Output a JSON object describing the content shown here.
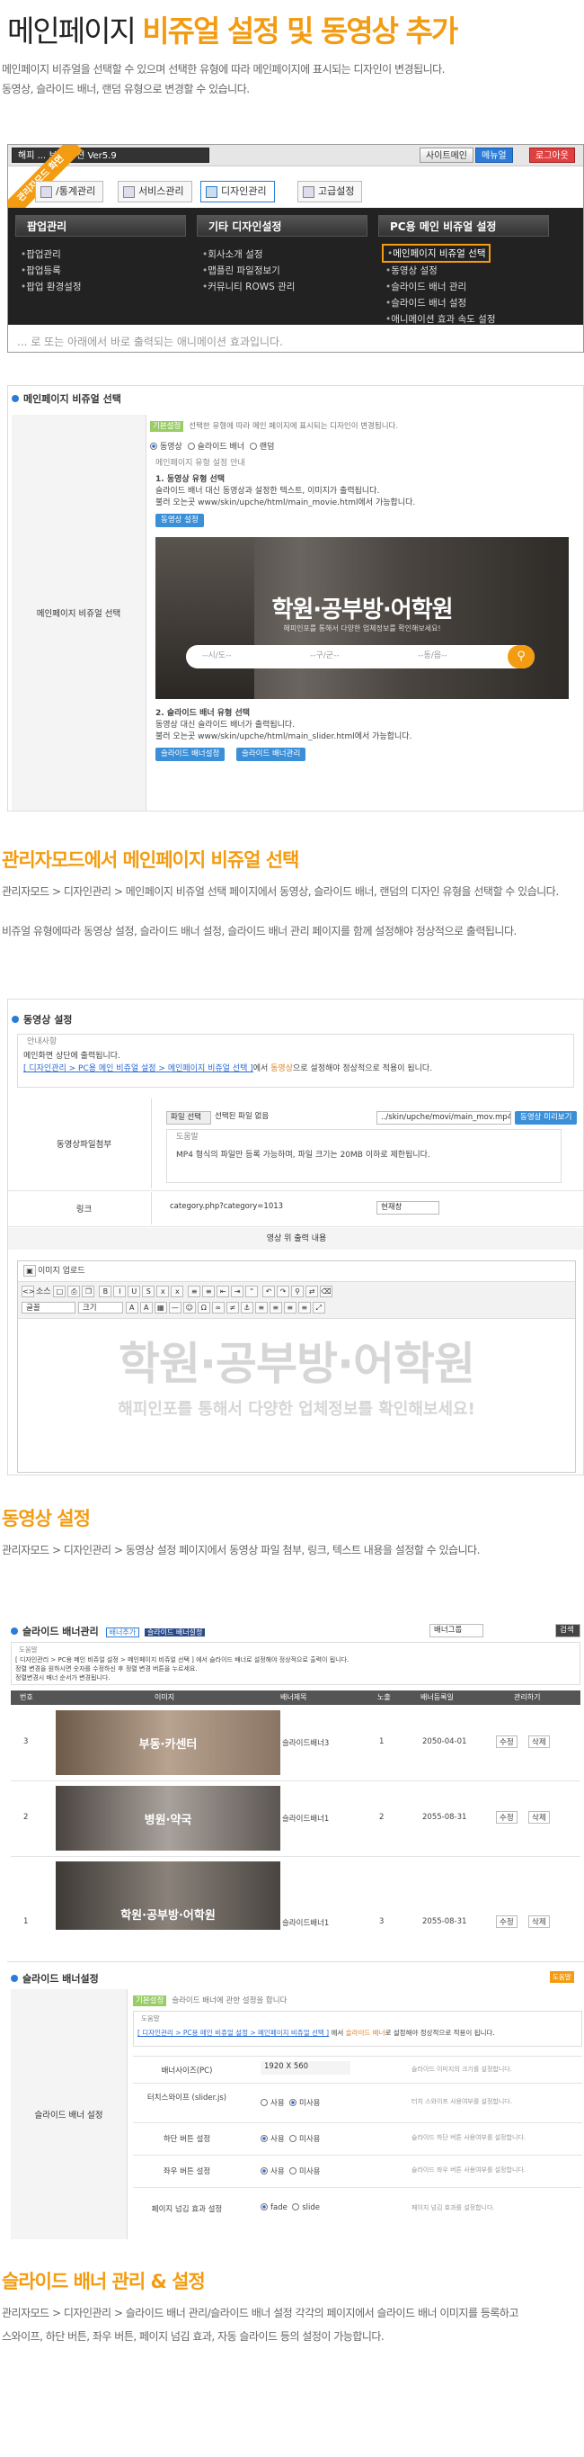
{
  "header": {
    "title_plain": "메인페이지 ",
    "title_highlight": "비쥬얼 설정 및 동영상 추가",
    "desc1": "메인페이지 비쥬얼을 선택할 수 있으며 선택한 유형에 따라 메인페이지에 표시되는 디자인이 변경됩니다.",
    "desc2": "동영상, 슬라이드 배너, 랜덤 유형으로 변경할 수 있습니다."
  },
  "shot1": {
    "app_title": "해피 ... 보 솔루션 Ver5.9",
    "top_buttons": [
      "사이트메인",
      "메뉴얼",
      "로그아웃"
    ],
    "ribbon": "관리자모드 화면",
    "tabs": [
      "/통계관리",
      "서비스관리",
      "디자인관리",
      "고급설정"
    ],
    "menu_heads": [
      "팝업관리",
      "기타 디자인설정",
      "PC용 메인 비쥬얼 설정"
    ],
    "col1": [
      "팝업관리",
      "팝업등록",
      "팝업 환경설정"
    ],
    "col2": [
      "회사소개 설정",
      "맵플린 파일정보기",
      "커뮤니티 ROWS 관리"
    ],
    "col3": [
      "메인페이지 비쥬얼 선택",
      "동영상 설정",
      "슬라이드 배너 관리",
      "슬라이드 배너 설정",
      "애니메이션 효과 속도 설정"
    ],
    "overlay": "... 로 또는 아래에서 바로 출력되는 애니메이션 효과입니다."
  },
  "shot2": {
    "title": "메인페이지 비쥬얼 선택",
    "row_label": "메인페이지 비쥬얼 선택",
    "tag": "기본설정",
    "tag_text": "선택한 유형에 따라 메인 페이지에 표시되는 디자인이 변경됩니다.",
    "options": [
      "동영상",
      "슬라이드 배너",
      "랜덤"
    ],
    "sub_note": "메인페이지 유형 설정 안내",
    "type1_title": "1. 동영상 유형 선택",
    "type1_l1": "슬라이드 배너 대신 동영상과 설정한 텍스트, 이미지가 출력됩니다.",
    "type1_l2": "불러 오는곳 www/skin/upche/html/main_movie.html에서 가능합니다.",
    "btn_video": "동영상 설정",
    "hero_title": "학원·공부방·어학원",
    "hero_sub": "해피인포를 통해서 다양한 업체정보를 확인해보세요!",
    "hero_selects": [
      "--시/도--",
      "--구/군--",
      "--동/읍--"
    ],
    "type2_title": "2. 슬라이드 배너 유형 선택",
    "type2_l1": "동영상 대신 슬라이드 배너가 출력됩니다.",
    "type2_l2": "불러 오는곳 www/skin/upche/html/main_slider.html에서 가능합니다.",
    "btn_slide1": "슬라이드 배너설정",
    "btn_slide2": "슬라이드 배너관리"
  },
  "section2": {
    "heading": "관리자모드에서 메인페이지 비쥬얼 선택",
    "desc1": "관리자모드 > 디자인관리 > 메인페이지 비쥬얼 선택 페이지에서 동영상, 슬라이드 배너, 랜덤의 디자인 유형을 선택할 수 있습니다.",
    "desc2": "비쥬얼 유형에따라 동영상 설정, 슬라이드 배너 설정, 슬라이드 배너 관리 페이지를 함께 설정해야 정상적으로 출력됩니다."
  },
  "shot3": {
    "title": "동영상 설정",
    "guide_label": "안내사항",
    "guide1": "메인화면 상단에 출력됩니다.",
    "guide2_pre": "[ 디자인관리 > PC용 메인 비쥬얼 설정 > 메인페이지 비쥬얼 선택 ]",
    "guide2_mid": "에서 ",
    "guide2_hl": "동영상",
    "guide2_post": "으로 설정해야 정상적으로 적용이 됩니다.",
    "file_label": "동영상파일첨부",
    "file_btn": "파일 선택",
    "file_none": "선택된 파일 없음",
    "file_path": "../skin/upche/movi/main_mov.mp4",
    "file_btn2": "동영상 미리보기",
    "file_note_label": "도움말",
    "file_note": "MP4 형식의 파일만 등록 가능하며, 파일 크기는 20MB 이하로 제한됩니다.",
    "link_label": "링크",
    "link_value": "category.php?category=1013",
    "link_target": "현재창",
    "text_label": "영상 위 출력 내용",
    "image_upload": "이미지 업로드",
    "editor_source": "소스",
    "font_sel": "글꼴",
    "size_sel": "크기",
    "preview_big": "학원·공부방·어학원",
    "preview_small": "해피인포를 통해서 다양한 업체정보를 확인해보세요!"
  },
  "section3": {
    "heading": "동영상 설정",
    "desc1": "관리자모드 > 디자인관리 > 동영상 설정 페이지에서 동영상 파일 첨부, 링크, 텍스트 내용을 설정할 수 있습니다."
  },
  "shot4": {
    "title": "슬라이드 배너관리",
    "badge1": "배너추가",
    "badge2": "슬라이드 배너설정",
    "select": "배너그룹",
    "btn": "검색",
    "help_label": "도움말",
    "help1": "[ 디자인관리 > PC용 메인 비쥬얼 설정 > 메인페이지 비쥬얼 선택 ] 에서 슬라이드 배너로 설정해야 정상적으로 출력이 됩니다.",
    "help2": "정렬 변경을 원하시면 숫자를 수정하신 후 정렬 변경 버튼을 누르세요.",
    "help3": "정렬변경시 배너 순서가 변경됩니다.",
    "cols": [
      "번호",
      "이미지",
      "배너제목",
      "노출",
      "배너등록일",
      "관리하기"
    ],
    "rows": [
      {
        "no": "3",
        "img": "부동·카센터",
        "name": "슬라이드배너3",
        "order": "1",
        "date": "2050-04-01"
      },
      {
        "no": "2",
        "img": "병원·약국",
        "name": "슬라이드배너1",
        "order": "2",
        "date": "2055-08-31"
      },
      {
        "no": "1",
        "img": "학원·공부방·어학원",
        "name": "슬라이드배너1",
        "order": "3",
        "date": "2055-08-31"
      }
    ],
    "edit": "수정",
    "del": "삭제"
  },
  "shot5": {
    "title": "슬라이드 배너설정",
    "top_badge": "도움말",
    "tag": "기본설정",
    "tag_text": "슬라이드 배너에 관한 설정을 합니다",
    "help_label": "도움말",
    "help_pre": "[ 디자인관리 > PC용 메인 비쥬얼 설정 > 메인페이지 비쥬얼 선택 ]",
    "help_mid": " 에서 ",
    "help_hl": "슬라이드 배너",
    "help_post": "로 설정해야 정상적으로 적용이 됩니다.",
    "left_label": "슬라이드 배너 설정",
    "rows": [
      {
        "label": "배너사이즈(PC)",
        "value": "1920  X  560",
        "note": "슬라이드 이미지의 크기를 설정합니다."
      },
      {
        "label": "터치스와이프 (slider.js)",
        "value": "",
        "note": "터치 스와이프 사용여부를 설정합니다."
      },
      {
        "label": "하단 버튼 설정",
        "value": "",
        "note": "슬라이드 하단 버튼 사용여부를 설정합니다."
      },
      {
        "label": "좌우 버튼 설정",
        "value": "",
        "note": "슬라이드 좌우 버튼 사용여부를 설정합니다."
      },
      {
        "label": "페이지 넘김 효과 설정",
        "value": "",
        "note": "페이지 넘김 효과를 설정합니다."
      }
    ],
    "radio_use": "사용",
    "radio_nouse": "미사용",
    "fade": "fade",
    "slide": "slide"
  },
  "section4": {
    "heading": "슬라이드 배너 관리 & 설정",
    "desc1": "관리자모드 > 디자인관리 > 슬라이드 배너 관리/슬라이드 배너 설정 각각의 페이지에서 슬라이드 배너 이미지를 등록하고",
    "desc2": "스와이프, 하단 버튼, 좌우 버튼, 페이지 넘김 효과, 자동 슬라이드 등의 설정이 가능합니다."
  }
}
